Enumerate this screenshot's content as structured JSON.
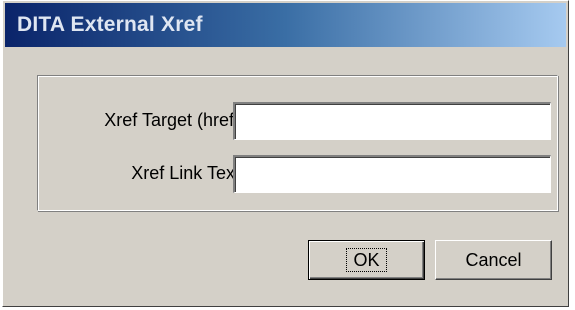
{
  "window": {
    "title": "DITA External Xref"
  },
  "form": {
    "href_label": "Xref Target (href):",
    "href_value": "",
    "link_text_label": "Xref Link Text:",
    "link_text_value": ""
  },
  "buttons": {
    "ok_label": "OK",
    "cancel_label": "Cancel"
  },
  "colors": {
    "dialog_face": "#d4d0c8",
    "titlebar_start": "#0a246a",
    "titlebar_end": "#a6caf0"
  }
}
